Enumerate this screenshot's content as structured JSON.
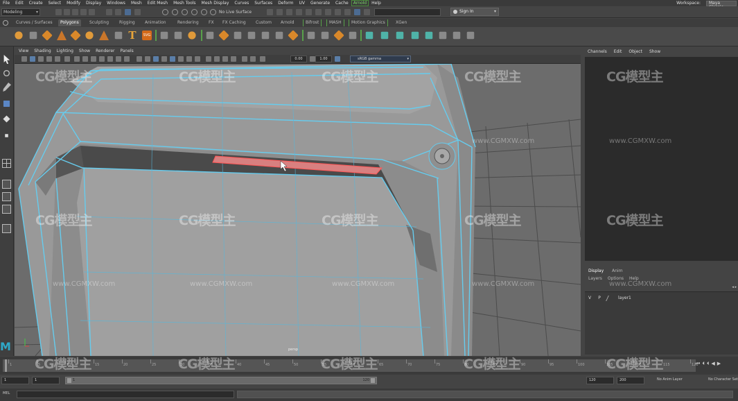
{
  "menubar": {
    "items": [
      "File",
      "Edit",
      "Create",
      "Select",
      "Modify",
      "Display",
      "Windows",
      "Mesh",
      "Edit Mesh",
      "Mesh Tools",
      "Mesh Display",
      "Curves",
      "Surfaces",
      "Deform",
      "UV",
      "Generate",
      "Cache",
      "Arnold",
      "Help"
    ],
    "highlighted_index": 17,
    "workspace_label": "Workspace:",
    "workspace_value": "Maya Classic"
  },
  "status": {
    "mode": "Modeling",
    "live_surface": "No Live Surface",
    "sign_in": "Sign In"
  },
  "shelf_tabs": {
    "items": [
      "Curves / Surfaces",
      "Polygons",
      "Sculpting",
      "Rigging",
      "Animation",
      "Rendering",
      "FX",
      "FX Caching",
      "Custom",
      "Arnold",
      "Bifrost",
      "MASH",
      "Motion Graphics",
      "XGen"
    ],
    "active": "Polygons"
  },
  "viewport": {
    "menu": [
      "View",
      "Shading",
      "Lighting",
      "Show",
      "Renderer",
      "Panels"
    ],
    "field_a": "0.00",
    "field_b": "1.00",
    "color_space": "sRGB gamma",
    "camera": "persp"
  },
  "channel_box": {
    "menu": [
      "Channels",
      "Edit",
      "Object",
      "Show"
    ]
  },
  "layer_editor": {
    "tabs": [
      "Display",
      "Anim"
    ],
    "active_tab": "Display",
    "menu": [
      "Layers",
      "Options",
      "Help"
    ],
    "layers": [
      {
        "visible": "V",
        "playback": "P",
        "name": "layer1"
      }
    ]
  },
  "time_slider": {
    "ticks": [
      "1",
      "5",
      "10",
      "15",
      "20",
      "25",
      "30",
      "35",
      "40",
      "45",
      "50",
      "55",
      "60",
      "65",
      "70",
      "75",
      "80",
      "85",
      "90",
      "95",
      "100",
      "105",
      "110",
      "115",
      "120"
    ]
  },
  "range": {
    "start": "1",
    "start_inner": "1",
    "slider_start": "1",
    "slider_end": "120",
    "end_inner": "120",
    "end": "200",
    "anim_layer": "No Anim Layer",
    "character_set": "No Character Set"
  },
  "command_line": {
    "label": "MEL"
  },
  "watermarks": {
    "logo": "CG模型主",
    "url": "www.CGMXW.com"
  }
}
